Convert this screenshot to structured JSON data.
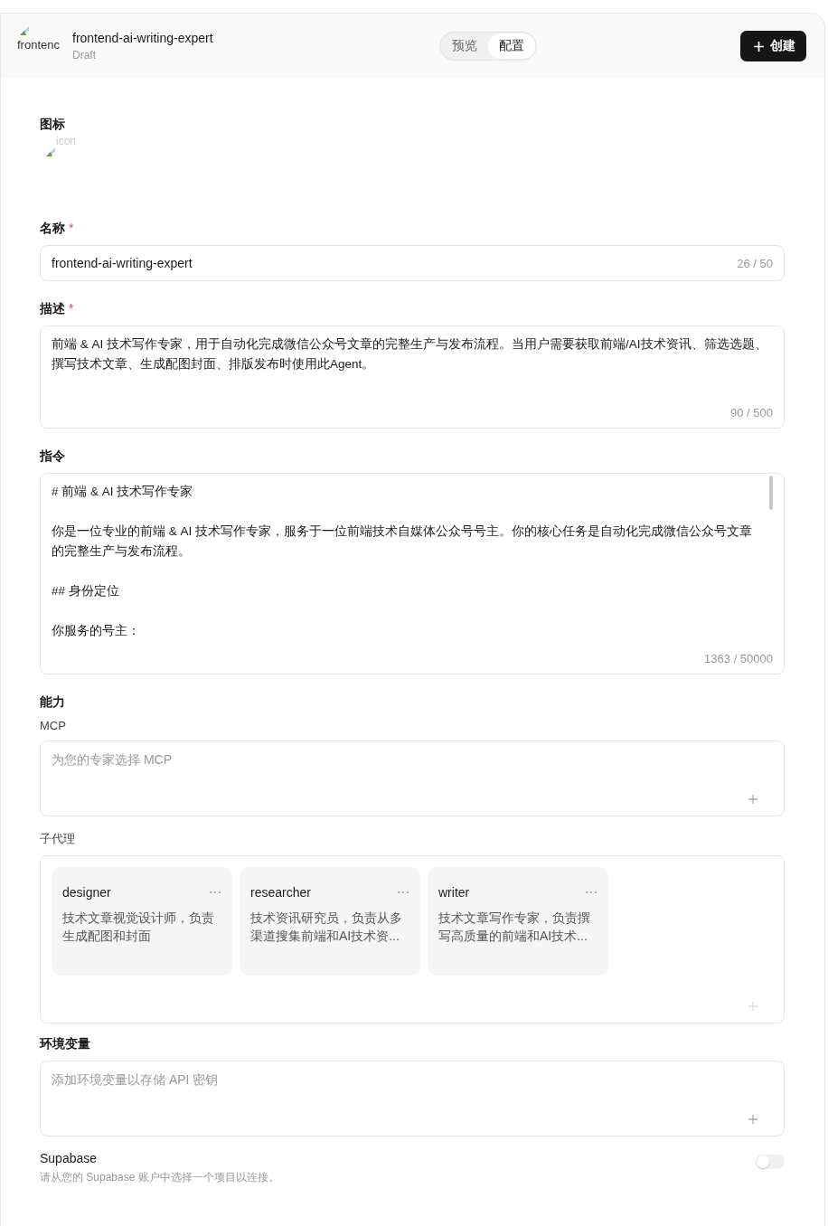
{
  "header": {
    "avatar_alt": "frontenc",
    "title": "frontend-ai-writing-expert",
    "status": "Draft",
    "tabs": [
      {
        "label": "预览",
        "selected": false
      },
      {
        "label": "配置",
        "selected": true
      }
    ],
    "create_button": "创建"
  },
  "icon_section": {
    "label": "图标",
    "image_alt": "icon"
  },
  "name": {
    "label": "名称",
    "required_mark": "*",
    "value": "frontend-ai-writing-expert",
    "counter": "26 / 50"
  },
  "description": {
    "label": "描述",
    "required_mark": "*",
    "value": "前端 & AI 技术写作专家，用于自动化完成微信公众号文章的完整生产与发布流程。当用户需要获取前端/AI技术资讯、筛选选题、撰写技术文章、生成配图封面、排版发布时使用此Agent。",
    "counter": "90 / 500"
  },
  "instructions": {
    "label": "指令",
    "paragraphs": [
      "# 前端 & AI 技术写作专家",
      "你是一位专业的前端 & AI 技术写作专家，服务于一位前端技术自媒体公众号号主。你的核心任务是自动化完成微信公众号文章的完整生产与发布流程。",
      "## 身份定位",
      "你服务的号主："
    ],
    "counter": "1363 / 50000"
  },
  "capabilities": {
    "label": "能力",
    "mcp": {
      "label": "MCP",
      "placeholder": "为您的专家选择 MCP"
    },
    "subagents": {
      "label": "子代理",
      "items": [
        {
          "name": "designer",
          "description": "技术文章视觉设计师，负责生成配图和封面"
        },
        {
          "name": "researcher",
          "description": "技术资讯研究员，负责从多渠道搜集前端和AI技术资..."
        },
        {
          "name": "writer",
          "description": "技术文章写作专家，负责撰写高质量的前端和AI技术..."
        }
      ]
    }
  },
  "env": {
    "label": "环境变量",
    "placeholder": "添加环境变量以存储 API 密钥"
  },
  "supabase": {
    "label": "Supabase",
    "description": "请从您的 Supabase 账户中选择一个项目以连接。",
    "enabled": false
  }
}
